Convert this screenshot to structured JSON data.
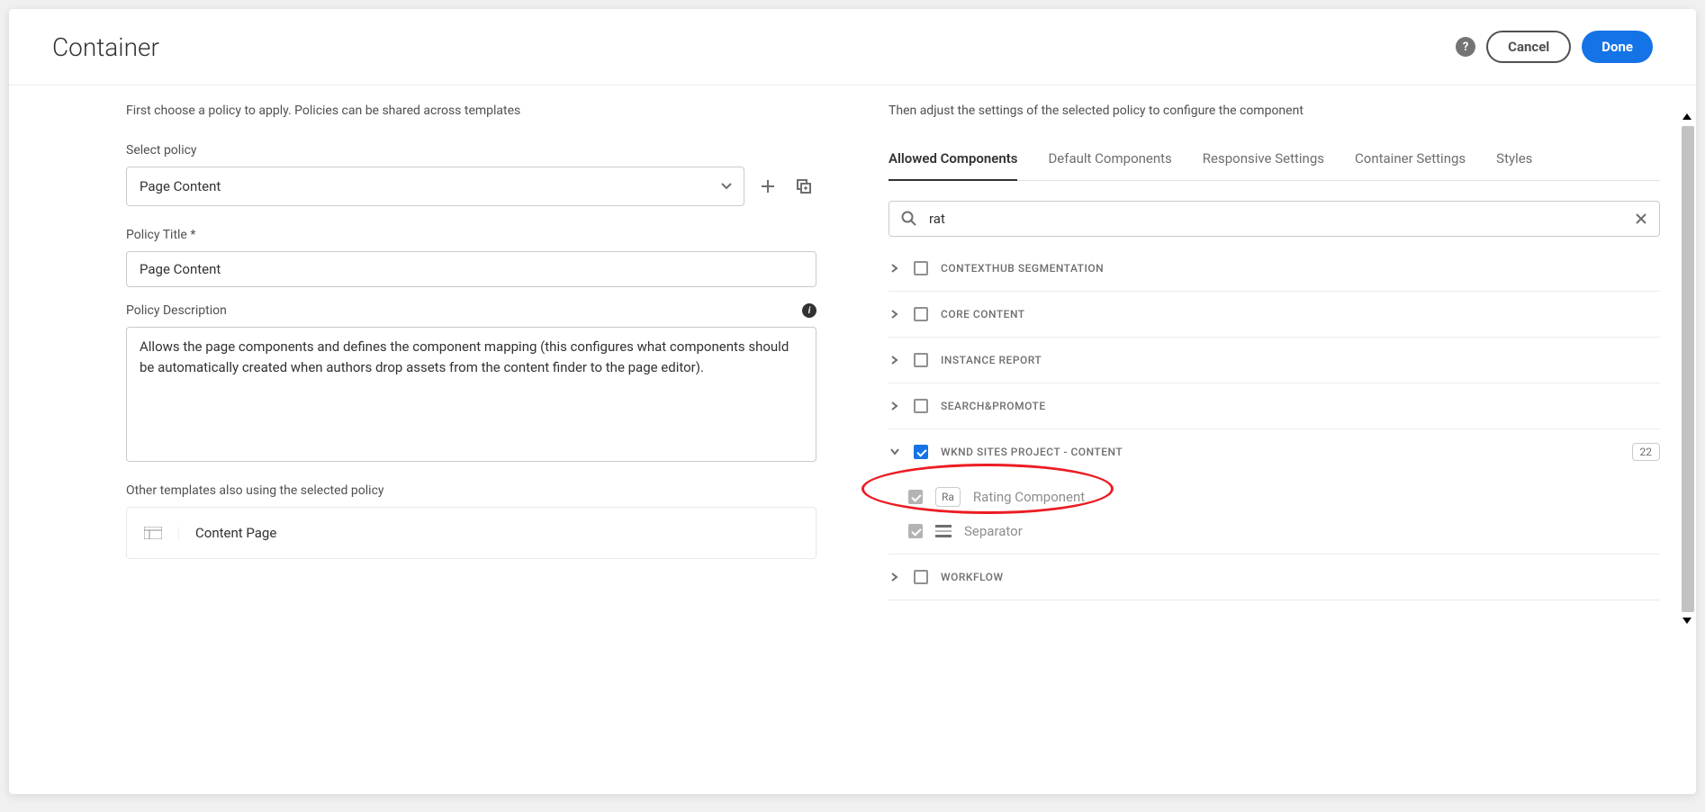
{
  "header": {
    "title": "Container",
    "cancel": "Cancel",
    "done": "Done"
  },
  "left": {
    "intro": "First choose a policy to apply. Policies can be shared across templates",
    "select_label": "Select policy",
    "select_value": "Page Content",
    "title_label": "Policy Title *",
    "title_value": "Page Content",
    "desc_label": "Policy Description",
    "desc_value": "Allows the page components and defines the component mapping (this configures what components should be automatically created when authors drop assets from the content finder to the page editor).",
    "other_label": "Other templates also using the selected policy",
    "template_name": "Content Page"
  },
  "right": {
    "intro": "Then adjust the settings of the selected policy to configure the component",
    "tabs": {
      "allowed": "Allowed Components",
      "default": "Default Components",
      "responsive": "Responsive Settings",
      "container": "Container Settings",
      "styles": "Styles"
    },
    "search": "rat",
    "groups": {
      "g0": "CONTEXTHUB SEGMENTATION",
      "g1": "CORE CONTENT",
      "g2": "INSTANCE REPORT",
      "g3": "SEARCH&PROMOTE",
      "g4": "WKND SITES PROJECT - CONTENT",
      "g4_badge": "22",
      "g4_item0_abbr": "Ra",
      "g4_item0": "Rating Component",
      "g4_item1": "Separator",
      "g5": "WORKFLOW"
    }
  }
}
